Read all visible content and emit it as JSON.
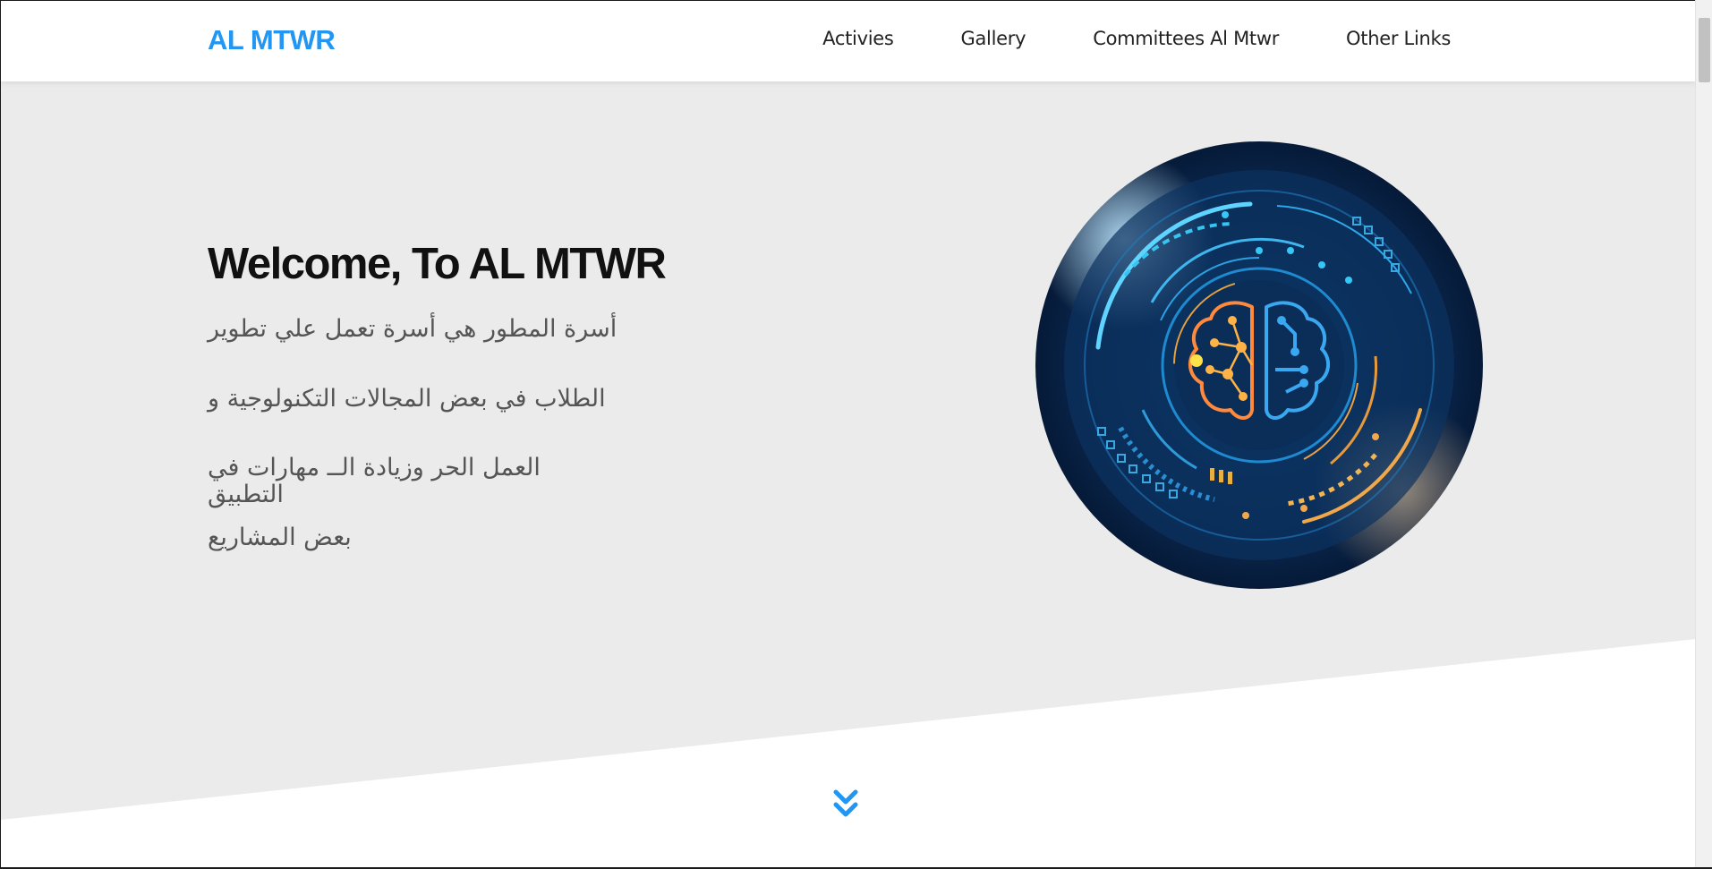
{
  "header": {
    "logo": "AL MTWR",
    "nav": [
      {
        "label": "Activies"
      },
      {
        "label": "Gallery"
      },
      {
        "label": "Committees Al Mtwr"
      },
      {
        "label": "Other Links"
      }
    ]
  },
  "hero": {
    "title": "Welcome, To AL MTWR",
    "lines": [
      "أسرة المطور هي أسرة تعمل علي تطوير",
      "الطلاب في بعض المجالات التكنولوجية و",
      "العمل الحر وزيادة الــ مهارات في التطبيق",
      "بعض المشاريع"
    ],
    "image_icon": "brain-circuit-icon",
    "scroll_icon": "double-chevron-down-icon"
  },
  "colors": {
    "brand": "#2196f3",
    "hero_bg": "#ebebeb",
    "text_dark": "#111111",
    "text_muted": "#555555"
  }
}
